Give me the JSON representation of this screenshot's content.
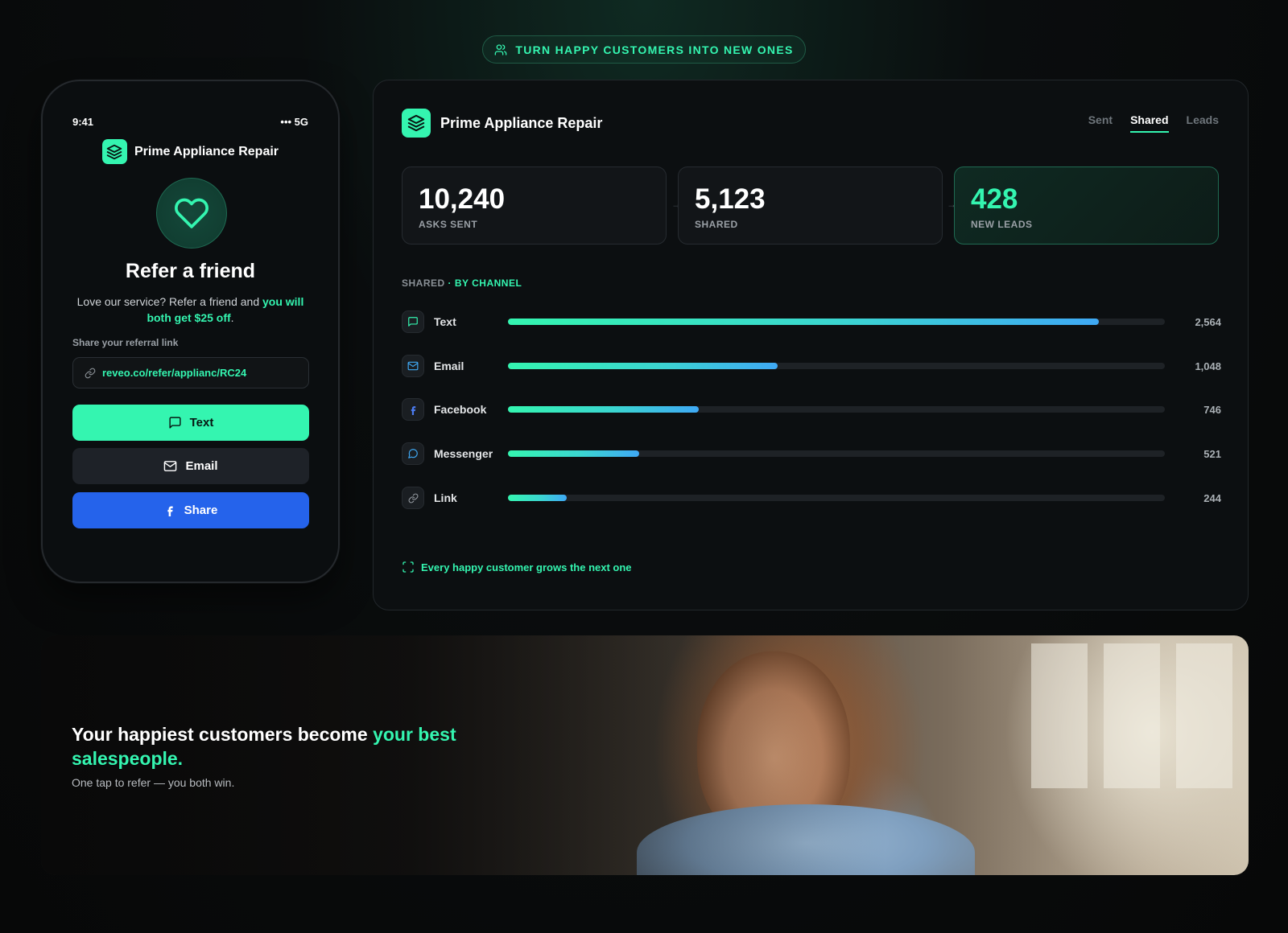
{
  "banner": {
    "text": "TURN HAPPY CUSTOMERS INTO NEW ONES",
    "icon": "users-icon"
  },
  "phone": {
    "time": "9:41",
    "network": "••• 5G",
    "brand": "Prime Appliance Repair",
    "title": "Refer a friend",
    "subtitle_plain": "Love our service? Refer a friend and ",
    "subtitle_highlight": "you will both get $25 off",
    "subtitle_end": ".",
    "share_label": "Share your referral link",
    "link": "reveo.co/refer/applianc/RC24",
    "buttons": {
      "text": "Text",
      "email": "Email",
      "share": "Share"
    }
  },
  "dashboard": {
    "brand": "Prime Appliance Repair",
    "tabs": [
      {
        "label": "Sent",
        "active": false
      },
      {
        "label": "Shared",
        "active": true
      },
      {
        "label": "Leads",
        "active": false
      }
    ],
    "stats": [
      {
        "value": "10,240",
        "label": "ASKS SENT"
      },
      {
        "value": "5,123",
        "label": "SHARED"
      },
      {
        "value": "428",
        "label": "NEW LEADS"
      }
    ],
    "section_label_grey": "SHARED",
    "section_label_green": "· BY CHANNEL",
    "channels": [
      {
        "name": "Text",
        "value": "2,564",
        "fraction": 0.9,
        "icon": "message-square-icon"
      },
      {
        "name": "Email",
        "value": "1,048",
        "fraction": 0.41,
        "icon": "mail-icon"
      },
      {
        "name": "Facebook",
        "value": "746",
        "fraction": 0.29,
        "icon": "facebook-icon"
      },
      {
        "name": "Messenger",
        "value": "521",
        "fraction": 0.2,
        "icon": "message-circle-icon"
      },
      {
        "name": "Link",
        "value": "244",
        "fraction": 0.09,
        "icon": "link-icon"
      }
    ],
    "footer": "Every happy customer grows the next one"
  },
  "hero": {
    "title_plain": "Your happiest customers become ",
    "title_highlight": "your best salespeople.",
    "subtitle": "One tap to refer — you both win."
  },
  "colors": {
    "accent": "#34f5b0",
    "facebook_blue": "#2563eb",
    "background": "#0a0d0e"
  }
}
